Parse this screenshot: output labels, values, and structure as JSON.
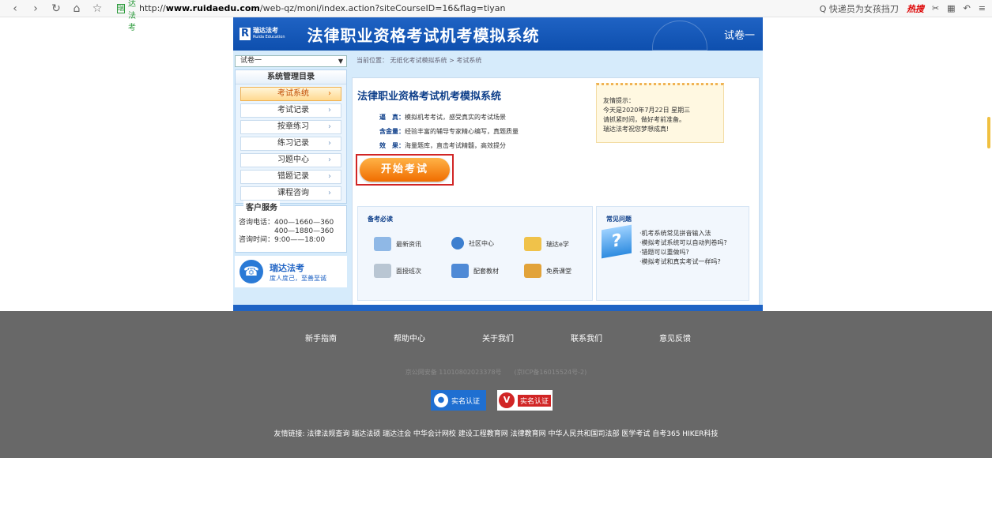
{
  "browser": {
    "nav_icons": [
      "‹",
      "›",
      "↻",
      "⌂",
      "☆"
    ],
    "site_badge": "瑞达法考",
    "url_prefix": "http://",
    "url_host": "www.ruidaedu.com",
    "url_path": "/web-qz/moni/index.action?siteCourseID=16&flag=tiyan",
    "search_text": "Q 快递员为女孩挡刀",
    "hot_label": "热搜"
  },
  "banner": {
    "logo_big": "瑞达法考",
    "logo_small": "Ruida Education",
    "title": "法律职业资格考试机考模拟系统",
    "paper": "试卷一"
  },
  "sidebar": {
    "select_value": "试卷一",
    "menu_title": "系统管理目录",
    "items": [
      {
        "label": "考试系统"
      },
      {
        "label": "考试记录"
      },
      {
        "label": "按章练习"
      },
      {
        "label": "练习记录"
      },
      {
        "label": "习题中心"
      },
      {
        "label": "错题记录"
      },
      {
        "label": "课程咨询"
      }
    ],
    "service_title": "客户服务",
    "service_lines": [
      "咨询电话：400—1660—360",
      "　　　　　400—1880—360",
      "咨询时间：9:00——18:00"
    ],
    "brand_name": "瑞达法考",
    "brand_slogan": "度人度己，至善至诚"
  },
  "breadcrumb": "当前位置： 无纸化考试模拟系统 > 考试系统",
  "content": {
    "title": "法律职业资格考试机考模拟系统",
    "features": [
      {
        "key": "逼　真：",
        "text": "模拟机考考试，感受真实的考试场景"
      },
      {
        "key": "含金量：",
        "text": "经验丰富的辅导专家精心编写，真题质量"
      },
      {
        "key": "效　果：",
        "text": "海量题库，直击考试精髓，高效提分"
      }
    ],
    "tips": [
      "友情提示：",
      "今天是2020年7月22日 星期三",
      "请抓紧时间，做好考前准备。",
      "瑞达法考祝您梦想成真!"
    ],
    "start_button": "开始考试",
    "prep_title": "备考必读",
    "prep_items": [
      "最新资讯",
      "社区中心",
      "瑞达e学",
      "面授班次",
      "配套教材",
      "免费课堂"
    ],
    "faq_title": "常见问题",
    "faq_items": [
      "·机考系统常见拼音输入法",
      "·模拟考试系统可以自动判卷吗?",
      "·错题可以重做吗?",
      "·模拟考试和真实考试一样吗?"
    ]
  },
  "footer": {
    "nav": [
      "新手指南",
      "帮助中心",
      "关于我们",
      "联系我们",
      "意见反馈"
    ],
    "beian": "京公网安备 11010802023378号　　(京ICP备16015524号-2)",
    "cert1": "实名认证",
    "cert2": "实名认证",
    "links": "友情链接: 法律法规查询  瑞达法硕  瑞达注会  中华会计网校  建设工程教育网  法律教育网  中华人民共和国司法部  医学考试  自考365  HIKER科技"
  },
  "colors": {
    "brand_blue": "#1f63c4",
    "accent_orange": "#f06d00",
    "highlight_red": "#d12525",
    "footer_gray": "#686868"
  }
}
